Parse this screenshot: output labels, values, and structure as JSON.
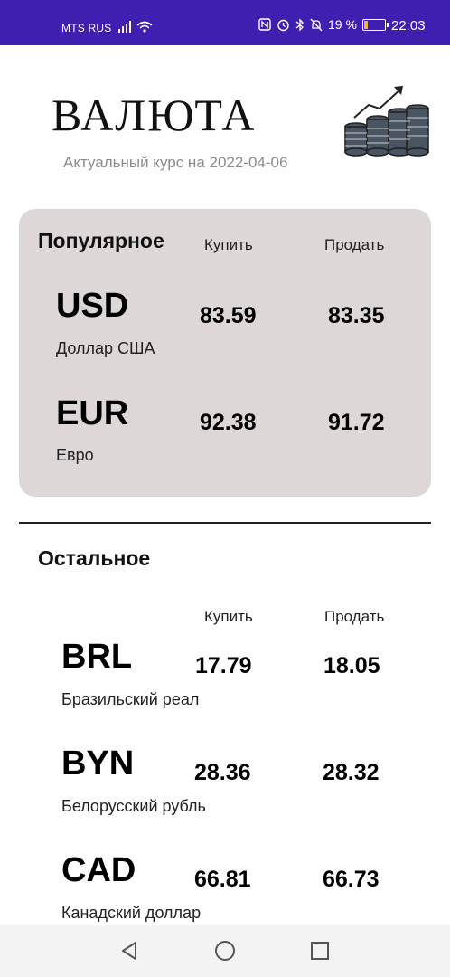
{
  "status_bar": {
    "carrier": "MTS RUS",
    "battery_percent": "19 %",
    "battery_level": 0.19,
    "time": "22:03",
    "battery_color": "#f2b33d",
    "bar_color": "#3f1fb0"
  },
  "header": {
    "title": "ВАЛЮТА",
    "subtitle": "Актуальный курс на 2022-04-06",
    "icon": "coins-chart-icon"
  },
  "popular": {
    "title": "Популярное",
    "buy_label": "Купить",
    "sell_label": "Продать",
    "card_color": "#ddd7d7",
    "rows": [
      {
        "code": "USD",
        "name": "Доллар США",
        "buy": "83.59",
        "sell": "83.35"
      },
      {
        "code": "EUR",
        "name": "Евро",
        "buy": "92.38",
        "sell": "91.72"
      }
    ]
  },
  "other": {
    "title": "Остальное",
    "buy_label": "Купить",
    "sell_label": "Продать",
    "rows": [
      {
        "code": "BRL",
        "name": "Бразильский реал",
        "buy": "17.79",
        "sell": "18.05"
      },
      {
        "code": "BYN",
        "name": "Белорусский рубль",
        "buy": "28.36",
        "sell": "28.32"
      },
      {
        "code": "CAD",
        "name": "Канадский доллар",
        "buy": "66.81",
        "sell": "66.73"
      }
    ]
  },
  "nav": {
    "back": "back-icon",
    "home": "home-icon",
    "recents": "recents-icon"
  }
}
